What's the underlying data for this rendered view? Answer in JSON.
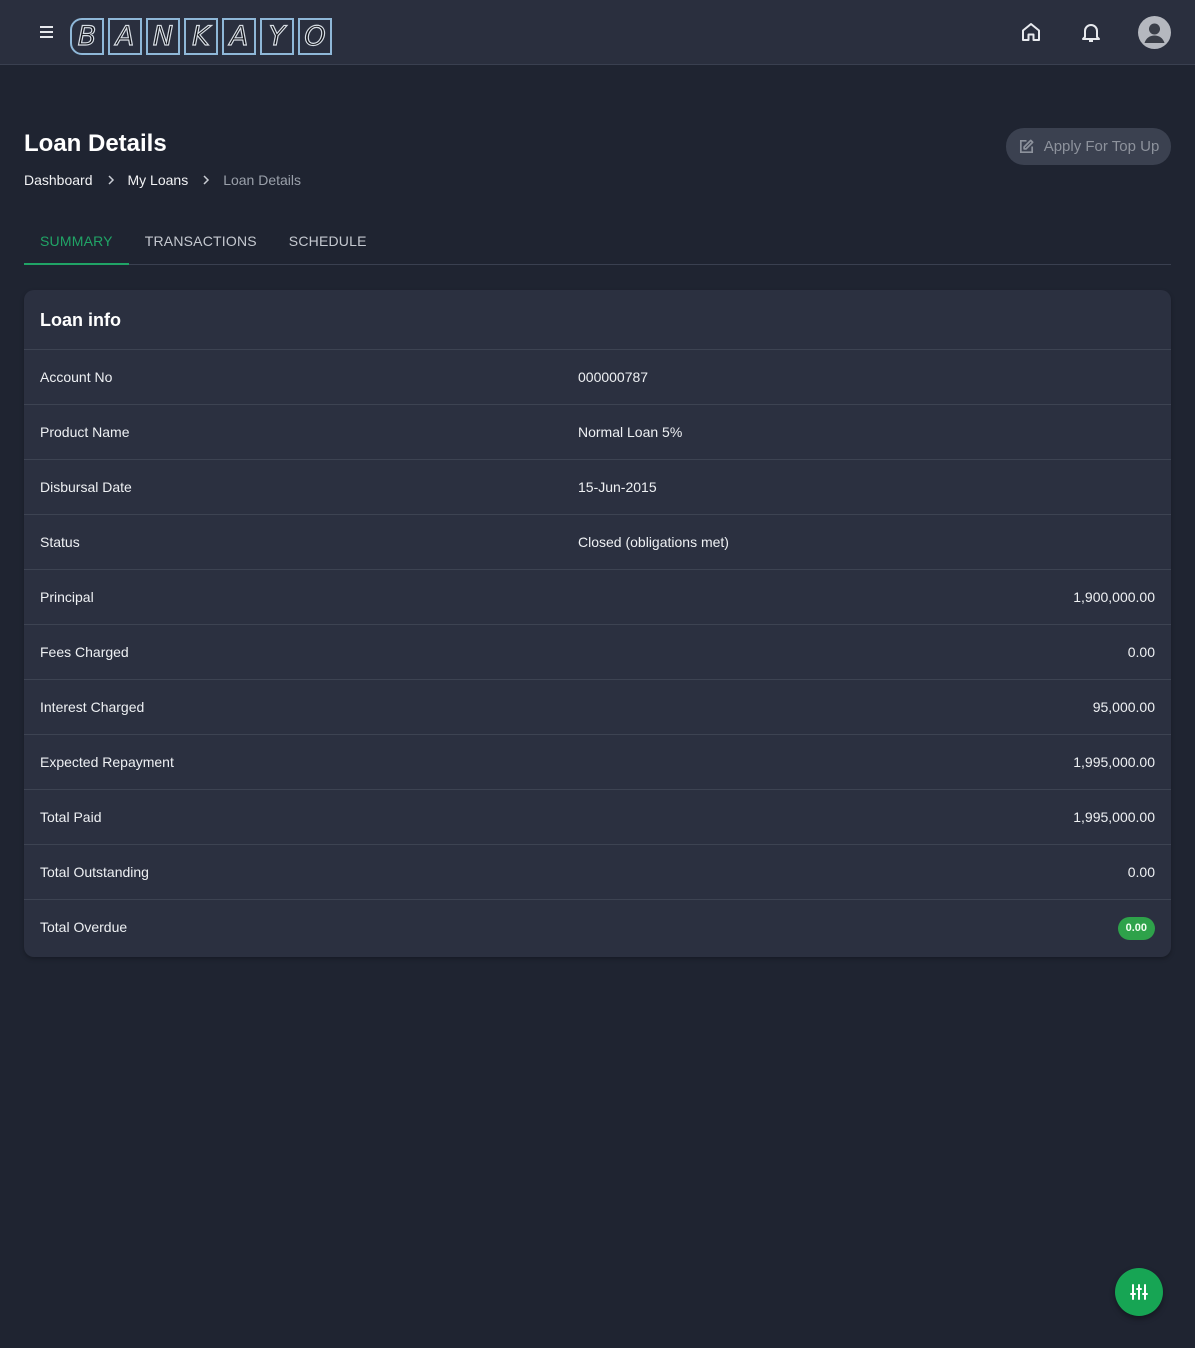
{
  "header": {
    "logo_letters": [
      "B",
      "A",
      "N",
      "K",
      "A",
      "Y",
      "O"
    ],
    "icons": [
      "menu-icon",
      "home-icon",
      "bell-icon",
      "avatar-icon"
    ]
  },
  "page": {
    "title": "Loan Details",
    "breadcrumb": [
      "Dashboard",
      "My Loans",
      "Loan Details"
    ],
    "topup_button": "Apply For Top Up"
  },
  "tabs": [
    "SUMMARY",
    "TRANSACTIONS",
    "SCHEDULE"
  ],
  "active_tab": "SUMMARY",
  "card": {
    "title": "Loan info",
    "rows": [
      {
        "label": "Account No",
        "value": "000000787"
      },
      {
        "label": "Product Name",
        "value": "Normal Loan 5%"
      },
      {
        "label": "Disbursal Date",
        "value": "15-Jun-2015"
      },
      {
        "label": "Status",
        "value": "Closed (obligations met)"
      },
      {
        "label": "Principal",
        "value": "1,900,000.00"
      },
      {
        "label": "Fees Charged",
        "value": "0.00"
      },
      {
        "label": "Interest Charged",
        "value": "95,000.00"
      },
      {
        "label": "Expected Repayment",
        "value": "1,995,000.00"
      },
      {
        "label": "Total Paid",
        "value": "1,995,000.00"
      },
      {
        "label": "Total Outstanding",
        "value": "0.00"
      },
      {
        "label": "Total Overdue",
        "value": "0.00"
      }
    ]
  },
  "colors": {
    "accent": "#20a466",
    "badge": "#2ea24a",
    "background": "#1f2431",
    "card": "#2b3040"
  }
}
